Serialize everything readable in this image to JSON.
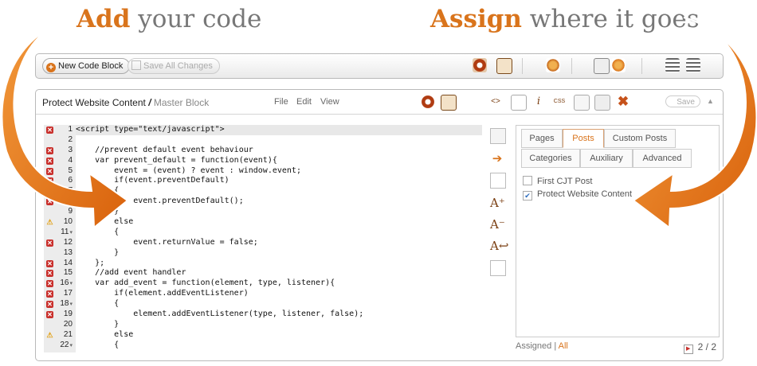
{
  "headlines": {
    "left": {
      "accent": "Add",
      "rest": " your code"
    },
    "right": {
      "accent": "Assign",
      "rest": " where it goes"
    }
  },
  "toolbar": {
    "new_block_label": "New Code Block",
    "save_all_label": "Save All Changes"
  },
  "panel": {
    "block_title": "Protect Website Content",
    "separator": "/",
    "parent_block": "Master Block",
    "menu": [
      "File",
      "Edit",
      "View"
    ],
    "save_label": "Save",
    "collapse_icon": "▲"
  },
  "editor": {
    "lines": [
      {
        "n": "1",
        "mark": "err",
        "fold": "",
        "code": "<script type=\"text/javascript\">"
      },
      {
        "n": "2",
        "mark": "",
        "fold": "",
        "code": ""
      },
      {
        "n": "3",
        "mark": "err",
        "fold": "",
        "code": "    //prevent default event behaviour"
      },
      {
        "n": "4",
        "mark": "err",
        "fold": "",
        "code": "    var prevent_default = function(event){"
      },
      {
        "n": "5",
        "mark": "err",
        "fold": "",
        "code": "        event = (event) ? event : window.event;"
      },
      {
        "n": "6",
        "mark": "err",
        "fold": "",
        "code": "        if(event.preventDefault)"
      },
      {
        "n": "7",
        "mark": "err",
        "fold": "",
        "code": "        {"
      },
      {
        "n": "8",
        "mark": "err",
        "fold": "",
        "code": "            event.preventDefault();"
      },
      {
        "n": "9",
        "mark": "",
        "fold": "",
        "code": "        }"
      },
      {
        "n": "10",
        "mark": "warn",
        "fold": "",
        "code": "        else"
      },
      {
        "n": "11",
        "mark": "",
        "fold": "▾",
        "code": "        {"
      },
      {
        "n": "12",
        "mark": "err",
        "fold": "",
        "code": "            event.returnValue = false;"
      },
      {
        "n": "13",
        "mark": "",
        "fold": "",
        "code": "        }"
      },
      {
        "n": "14",
        "mark": "err",
        "fold": "",
        "code": "    };"
      },
      {
        "n": "15",
        "mark": "err",
        "fold": "",
        "code": "    //add event handler"
      },
      {
        "n": "16",
        "mark": "err",
        "fold": "▾",
        "code": "    var add_event = function(element, type, listener){"
      },
      {
        "n": "17",
        "mark": "err",
        "fold": "",
        "code": "        if(element.addEventListener)"
      },
      {
        "n": "18",
        "mark": "err",
        "fold": "▾",
        "code": "        {"
      },
      {
        "n": "19",
        "mark": "err",
        "fold": "",
        "code": "            element.addEventListener(type, listener, false);"
      },
      {
        "n": "20",
        "mark": "",
        "fold": "",
        "code": "        }"
      },
      {
        "n": "21",
        "mark": "warn",
        "fold": "",
        "code": "        else"
      },
      {
        "n": "22",
        "mark": "",
        "fold": "▾",
        "code": "        {"
      }
    ]
  },
  "assign": {
    "tabs_row1": [
      {
        "label": "Pages",
        "active": false
      },
      {
        "label": "Posts",
        "active": true
      },
      {
        "label": "Custom Posts",
        "active": false
      }
    ],
    "tabs_row2": [
      {
        "label": "Categories",
        "active": false
      },
      {
        "label": "Auxiliary",
        "active": false
      },
      {
        "label": "Advanced",
        "active": false
      }
    ],
    "items": [
      {
        "label": "First CJT Post",
        "checked": false
      },
      {
        "label": "Protect Website Content",
        "checked": true
      }
    ],
    "footer": {
      "assigned": "Assigned",
      "divider": "|",
      "all": "All",
      "page": "2 / 2"
    }
  },
  "colors": {
    "accent": "#d9741c",
    "error": "#c9302c",
    "warning": "#e2a21b"
  }
}
